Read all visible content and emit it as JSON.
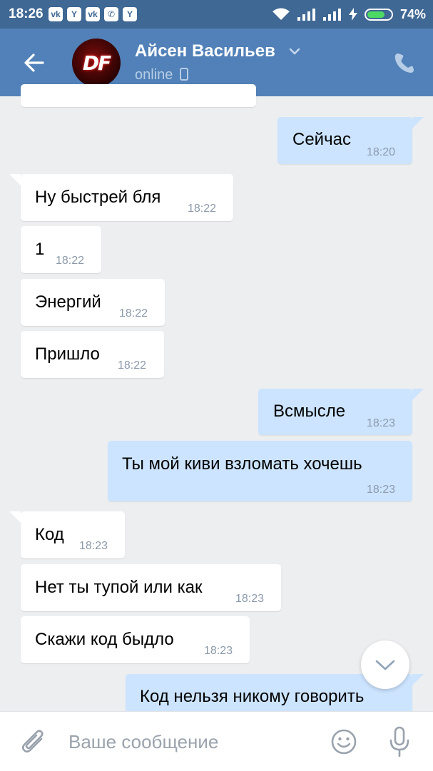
{
  "status_bar": {
    "time": "18:26",
    "notifications": [
      {
        "icon": "vk-icon",
        "glyph": "vk"
      },
      {
        "icon": "yandex-icon",
        "glyph": "Y"
      },
      {
        "icon": "vk-icon",
        "glyph": "vk"
      },
      {
        "icon": "viber-icon",
        "glyph": "✆"
      },
      {
        "icon": "yandex-icon",
        "glyph": "Y"
      }
    ],
    "battery_percent": "74%",
    "battery_level": 0.74
  },
  "header": {
    "contact_name": "Айсен Васильев",
    "status": "online",
    "avatar_text": "DF"
  },
  "messages": [
    {
      "dir": "in",
      "text": "",
      "time": ""
    },
    {
      "dir": "out",
      "text": "Сейчас",
      "time": "18:20"
    },
    {
      "dir": "in",
      "text": "Ну быстрей бля",
      "time": "18:22"
    },
    {
      "dir": "in",
      "text": "1",
      "time": "18:22"
    },
    {
      "dir": "in",
      "text": "Энергий",
      "time": "18:22"
    },
    {
      "dir": "in",
      "text": "Пришло",
      "time": "18:22"
    },
    {
      "dir": "out",
      "text": "Всмысле",
      "time": "18:23"
    },
    {
      "dir": "out",
      "text": "Ты мой киви взломать хочешь",
      "time": "18:23"
    },
    {
      "dir": "in",
      "text": "Код",
      "time": "18:23"
    },
    {
      "dir": "in",
      "text": "Нет ты тупой или как",
      "time": "18:23"
    },
    {
      "dir": "in",
      "text": "Скажи код быдло",
      "time": "18:23"
    },
    {
      "dir": "out",
      "text": "Код нельзя никому говорить",
      "time": ""
    }
  ],
  "composer": {
    "placeholder": "Ваше сообщение"
  },
  "colors": {
    "status_bar": "#3f6894",
    "header": "#5181b8",
    "incoming_bubble": "#ffffff",
    "outgoing_bubble": "#cce4ff",
    "background": "#edeef0"
  }
}
